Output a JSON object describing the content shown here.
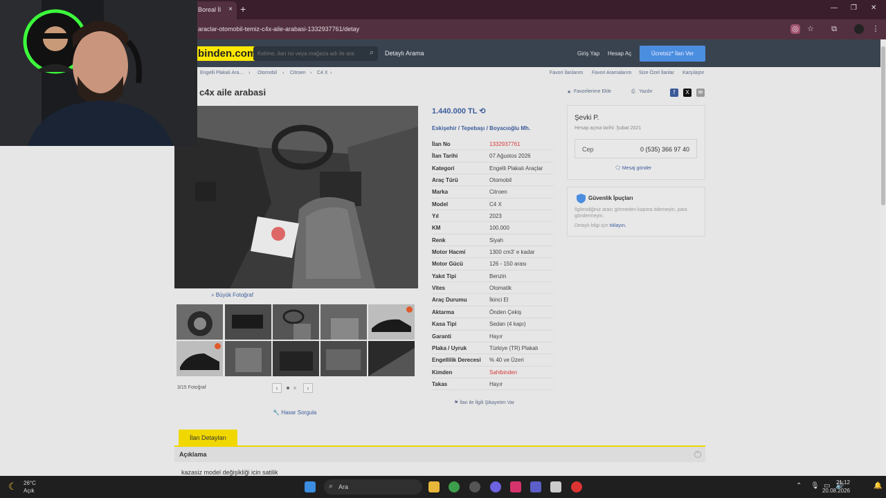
{
  "browser": {
    "tab_title": "Boreal İl",
    "tab_close": "×",
    "new_tab": "+",
    "url": "araclar-otomobil-temiz-c4x-aile-arabasi-1332937761/detay"
  },
  "site": {
    "logo": "binden.com",
    "search_placeholder": "Kelime, ilan no veya mağaza adı ile ara",
    "detayli_arama": "Detaylı Arama",
    "giris_yap": "Giriş Yap",
    "hesap_ac": "Hesap Aç",
    "ucretsiz_ilan": "Ücretsiz* İlan Ver"
  },
  "breadcrumb": [
    "Engelli Plakalı Ara...",
    "Otomobil",
    "Citroen",
    "C4 X"
  ],
  "breadcrumb_right": [
    "Favori İlanlarım",
    "Favori Aramalarım",
    "Size Özel İlanlar",
    "Karşılaştır"
  ],
  "listing": {
    "title": "c4x aile arabasi",
    "favorite": "Favorilerime Ekle",
    "print": "Yazdır",
    "price": "1.440.000 TL",
    "location": [
      "Eskişehir",
      "Tepebaşı",
      "Boyacıoğlu Mh."
    ],
    "big_photo": "Büyük Fotoğraf",
    "photo_count": "3/15 Fotoğraf",
    "hasar": "Hasar Sorgula",
    "sikayet": "İlan ile İlgili Şikayetim Var",
    "details": [
      {
        "k": "İlan No",
        "v": "1332937761",
        "red": true
      },
      {
        "k": "İlan Tarihi",
        "v": "07 Ağustos 2026"
      },
      {
        "k": "Kategori",
        "v": "Engelli Plakalı Araçlar"
      },
      {
        "k": "Araç Türü",
        "v": "Otomobil"
      },
      {
        "k": "Marka",
        "v": "Citroen"
      },
      {
        "k": "Model",
        "v": "C4 X"
      },
      {
        "k": "Yıl",
        "v": "2023"
      },
      {
        "k": "KM",
        "v": "100.000"
      },
      {
        "k": "Renk",
        "v": "Siyah"
      },
      {
        "k": "Motor Hacmi",
        "v": "1300 cm3' e kadar"
      },
      {
        "k": "Motor Gücü",
        "v": "126 - 150 arası"
      },
      {
        "k": "Yakıt Tipi",
        "v": "Benzin"
      },
      {
        "k": "Vites",
        "v": "Otomatik"
      },
      {
        "k": "Araç Durumu",
        "v": "İkinci El"
      },
      {
        "k": "Aktarma",
        "v": "Önden Çekiş"
      },
      {
        "k": "Kasa Tipi",
        "v": "Sedan (4 kapı)"
      },
      {
        "k": "Garanti",
        "v": "Hayır"
      },
      {
        "k": "Plaka / Uyruk",
        "v": "Türkiye (TR) Plakalı"
      },
      {
        "k": "Engellilik Derecesi",
        "v": "% 40 ve Üzeri"
      },
      {
        "k": "Kimden",
        "v": "Sahibinden",
        "red": true
      },
      {
        "k": "Takas",
        "v": "Hayır"
      }
    ]
  },
  "seller": {
    "name": "Şevki P.",
    "since": "Hesap açma tarihi: Şubat 2021",
    "cep_label": "Cep",
    "phone": "0 (535) 366 97 40",
    "message": "Mesaj gönder"
  },
  "security": {
    "title": "Güvenlik İpuçları",
    "text": "İlgilendiğiniz aracı görmeden kapora ödemeyin, para göndermeyin.",
    "more_prefix": "Detaylı bilgi için",
    "more_link": "tıklayın."
  },
  "tabs": {
    "ilan_detaylari": "İlan Detayları"
  },
  "description": {
    "heading": "Açıklama",
    "body": "kazasiz model değişikliği icin satilik"
  },
  "taskbar": {
    "temp": "26°C",
    "weather": "Açık",
    "search": "Ara",
    "time": "21:12",
    "date": "20.08.2026"
  },
  "colors": {
    "accent": "#ffe800",
    "link": "#3b5b9a",
    "header": "#39434f"
  }
}
